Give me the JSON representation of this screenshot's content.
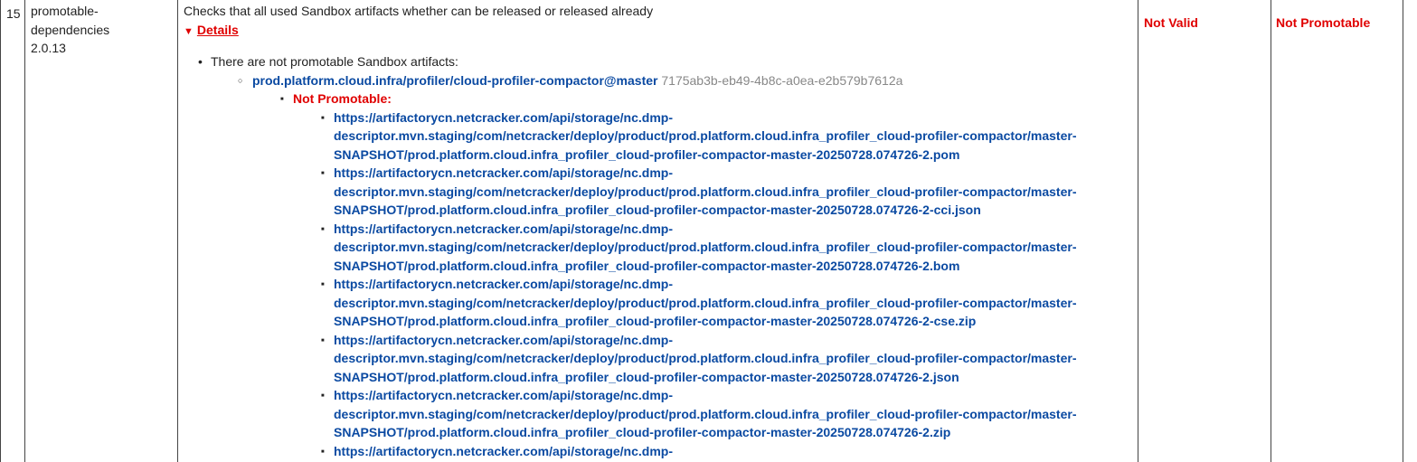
{
  "row": {
    "number": "15",
    "name_line1": "promotable-",
    "name_line2": "dependencies",
    "version": "2.0.13",
    "description": "Checks that all used Sandbox artifacts whether can be released or released already",
    "details_label": "Details",
    "summary": "There are not promotable Sandbox artifacts:",
    "artifact": {
      "name": "prod.platform.cloud.infra/profiler/cloud-profiler-compactor@master",
      "hash": "7175ab3b-eb49-4b8c-a0ea-e2b579b7612a",
      "status_label": "Not Promotable:",
      "links": [
        {
          "line1": "https://artifactorycn.netcracker.com/api/storage/nc.dmp-",
          "line2": "descriptor.mvn.staging/com/netcracker/deploy/product/prod.platform.cloud.infra_profiler_cloud-profiler-compactor/master-",
          "line3": "SNAPSHOT/prod.platform.cloud.infra_profiler_cloud-profiler-compactor-master-20250728.074726-2.pom"
        },
        {
          "line1": "https://artifactorycn.netcracker.com/api/storage/nc.dmp-",
          "line2": "descriptor.mvn.staging/com/netcracker/deploy/product/prod.platform.cloud.infra_profiler_cloud-profiler-compactor/master-",
          "line3": "SNAPSHOT/prod.platform.cloud.infra_profiler_cloud-profiler-compactor-master-20250728.074726-2-cci.json"
        },
        {
          "line1": "https://artifactorycn.netcracker.com/api/storage/nc.dmp-",
          "line2": "descriptor.mvn.staging/com/netcracker/deploy/product/prod.platform.cloud.infra_profiler_cloud-profiler-compactor/master-",
          "line3": "SNAPSHOT/prod.platform.cloud.infra_profiler_cloud-profiler-compactor-master-20250728.074726-2.bom"
        },
        {
          "line1": "https://artifactorycn.netcracker.com/api/storage/nc.dmp-",
          "line2": "descriptor.mvn.staging/com/netcracker/deploy/product/prod.platform.cloud.infra_profiler_cloud-profiler-compactor/master-",
          "line3": "SNAPSHOT/prod.platform.cloud.infra_profiler_cloud-profiler-compactor-master-20250728.074726-2-cse.zip"
        },
        {
          "line1": "https://artifactorycn.netcracker.com/api/storage/nc.dmp-",
          "line2": "descriptor.mvn.staging/com/netcracker/deploy/product/prod.platform.cloud.infra_profiler_cloud-profiler-compactor/master-",
          "line3": "SNAPSHOT/prod.platform.cloud.infra_profiler_cloud-profiler-compactor-master-20250728.074726-2.json"
        },
        {
          "line1": "https://artifactorycn.netcracker.com/api/storage/nc.dmp-",
          "line2": "descriptor.mvn.staging/com/netcracker/deploy/product/prod.platform.cloud.infra_profiler_cloud-profiler-compactor/master-",
          "line3": "SNAPSHOT/prod.platform.cloud.infra_profiler_cloud-profiler-compactor-master-20250728.074726-2.zip"
        },
        {
          "line1": "https://artifactorycn.netcracker.com/api/storage/nc.dmp-",
          "line2": "",
          "line3": ""
        }
      ]
    },
    "validity": "Not Valid",
    "promotion": "Not Promotable"
  },
  "colors": {
    "error": "#e00000",
    "link": "#0b4aa2",
    "muted": "#888888"
  }
}
